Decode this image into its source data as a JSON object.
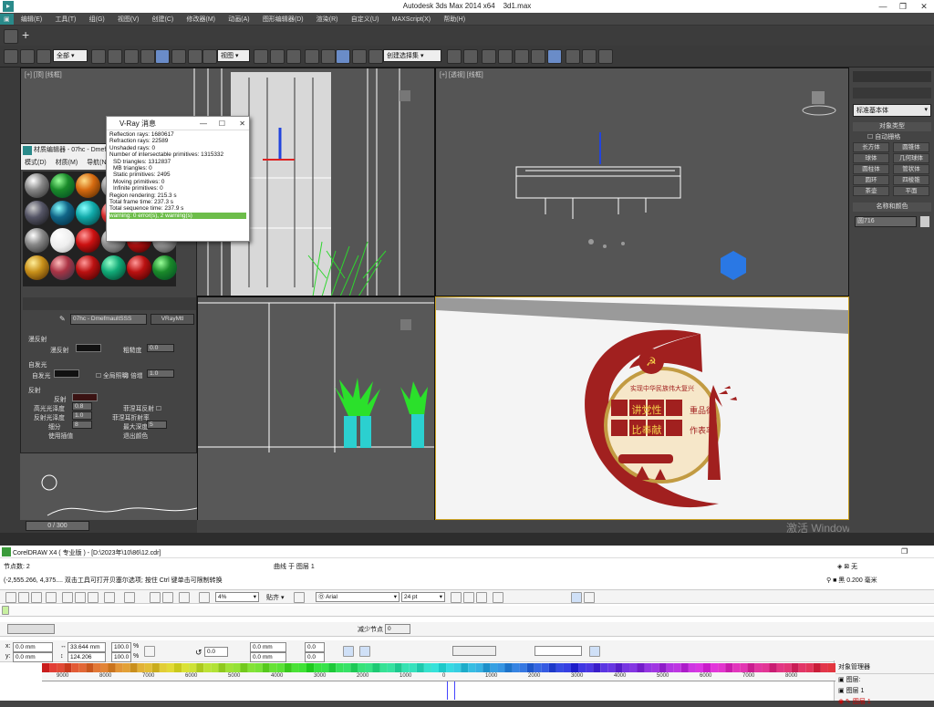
{
  "max": {
    "title": "Autodesk 3ds Max  2014 x64",
    "file": "3d1.max",
    "menu": [
      "编辑(E)",
      "工具(T)",
      "组(G)",
      "视图(V)",
      "创建(C)",
      "修改器(M)",
      "动画(A)",
      "图形编辑器(D)",
      "渲染(R)",
      "自定义(U)",
      "MAXScript(X)",
      "帮助(H)"
    ],
    "selection_filter": "全部",
    "ref_coord": "视图",
    "named_selection": "创建选择集",
    "viewport_labels": {
      "top_left": "[+] [顶] [线框]",
      "top_right": "[+] [透视] [线框]"
    },
    "timeline": "0 / 300",
    "watermark": "激活 Windows"
  },
  "command_panel": {
    "dropdown": "标准基本体",
    "rollout_object_type": "对象类型",
    "autogrid": "自动栅格",
    "buttons": [
      "长方体",
      "圆锥体",
      "球体",
      "几何球体",
      "圆柱体",
      "管状体",
      "圆环",
      "四棱锥",
      "茶壶",
      "平面"
    ],
    "rollout_name_color": "名称和颜色",
    "object_name": "圆716"
  },
  "vray": {
    "title": "V-Ray 消息",
    "lines": [
      "Reflection rays: 1680617",
      "Refraction rays: 22589",
      "Unshaded rays: 0",
      "Number of intersectable primitives: 1315332",
      "SD triangles: 1312837",
      "MB triangles: 0",
      "Static primitives: 2495",
      "Moving primitives: 0",
      "Infinite primitives: 0",
      "Region rendering: 215.3 s",
      "Total frame time: 237.3 s",
      "Total sequence time: 237.9 s"
    ],
    "warning": "warning: 0 error(s), 2 warning(s)"
  },
  "material_editor": {
    "title": "材质编辑器 - 07hc - Dmefi",
    "menu": [
      "模式(D)",
      "材质(M)",
      "导航(N)"
    ],
    "material_name": "07hc - DmefmaultSSS",
    "material_type": "VRayMtl",
    "section_diffuse": "漫反射",
    "diffuse_label": "漫反射",
    "roughness_label": "粗糙度",
    "roughness_val": "0.0",
    "section_self_illum": "自发光",
    "self_illum_label": "自发光",
    "gi_label": "全局照明",
    "multiplier_label": "倍增",
    "multiplier_val": "1.0",
    "section_reflect": "反射",
    "reflect_label": "反射",
    "hilight_gloss": "高光光泽度",
    "hilight_val": "0.8",
    "fresnel": "菲涅耳反射",
    "refl_gloss": "反射光泽度",
    "refl_gloss_val": "1.0",
    "fresnel_ior": "菲涅耳折射率",
    "subdivs": "细分",
    "subdivs_val": "8",
    "max_depth": "最大深度",
    "max_depth_val": "5",
    "use_interp": "使用插值",
    "exit_color": "退出颜色"
  },
  "cdr": {
    "title": "CorelDRAW X4 ( 专业版 ) - [D:\\2023年\\10\\86\\12.cdr]",
    "nodes": "节点数: 2",
    "curve_on_layer": "曲线 于 图层 1",
    "fill_none": "无",
    "outline": "黑  0.200 毫米",
    "status": "(-2,555.266, 4,375.... 双击工具可打开贝塞尔选项; 按住 Ctrl 键单击可限制转换",
    "zoom": "4%",
    "snap": "贴齐",
    "font": "Arial",
    "font_size": "24 pt",
    "reduce_nodes": "减少节点",
    "reduce_val": "0",
    "x": "0.0 mm",
    "y": "0.0 mm",
    "w": "33.644 mm",
    "h": "124.206 mm",
    "sx": "100.0",
    "sy": "100.0",
    "rot": "0.0",
    "p1": "0.0 mm",
    "p2": "0.0 mm",
    "q1": "0.0",
    "q2": "0.0",
    "obj_mgr": "对象管理器",
    "layer_a": "图层:",
    "layer_b": "图层 1",
    "layer_c": "图层 1",
    "ruler_ticks": [
      "9000",
      "8000",
      "7000",
      "6000",
      "5000",
      "4000",
      "3000",
      "2000",
      "1000",
      "0",
      "1000",
      "2000",
      "3000",
      "4000",
      "5000",
      "6000",
      "7000",
      "8000"
    ]
  },
  "emblem": {
    "title": "实现中华民族伟大复兴",
    "big": [
      "讲党性",
      "重品德",
      "比奉献",
      "作表率"
    ]
  }
}
